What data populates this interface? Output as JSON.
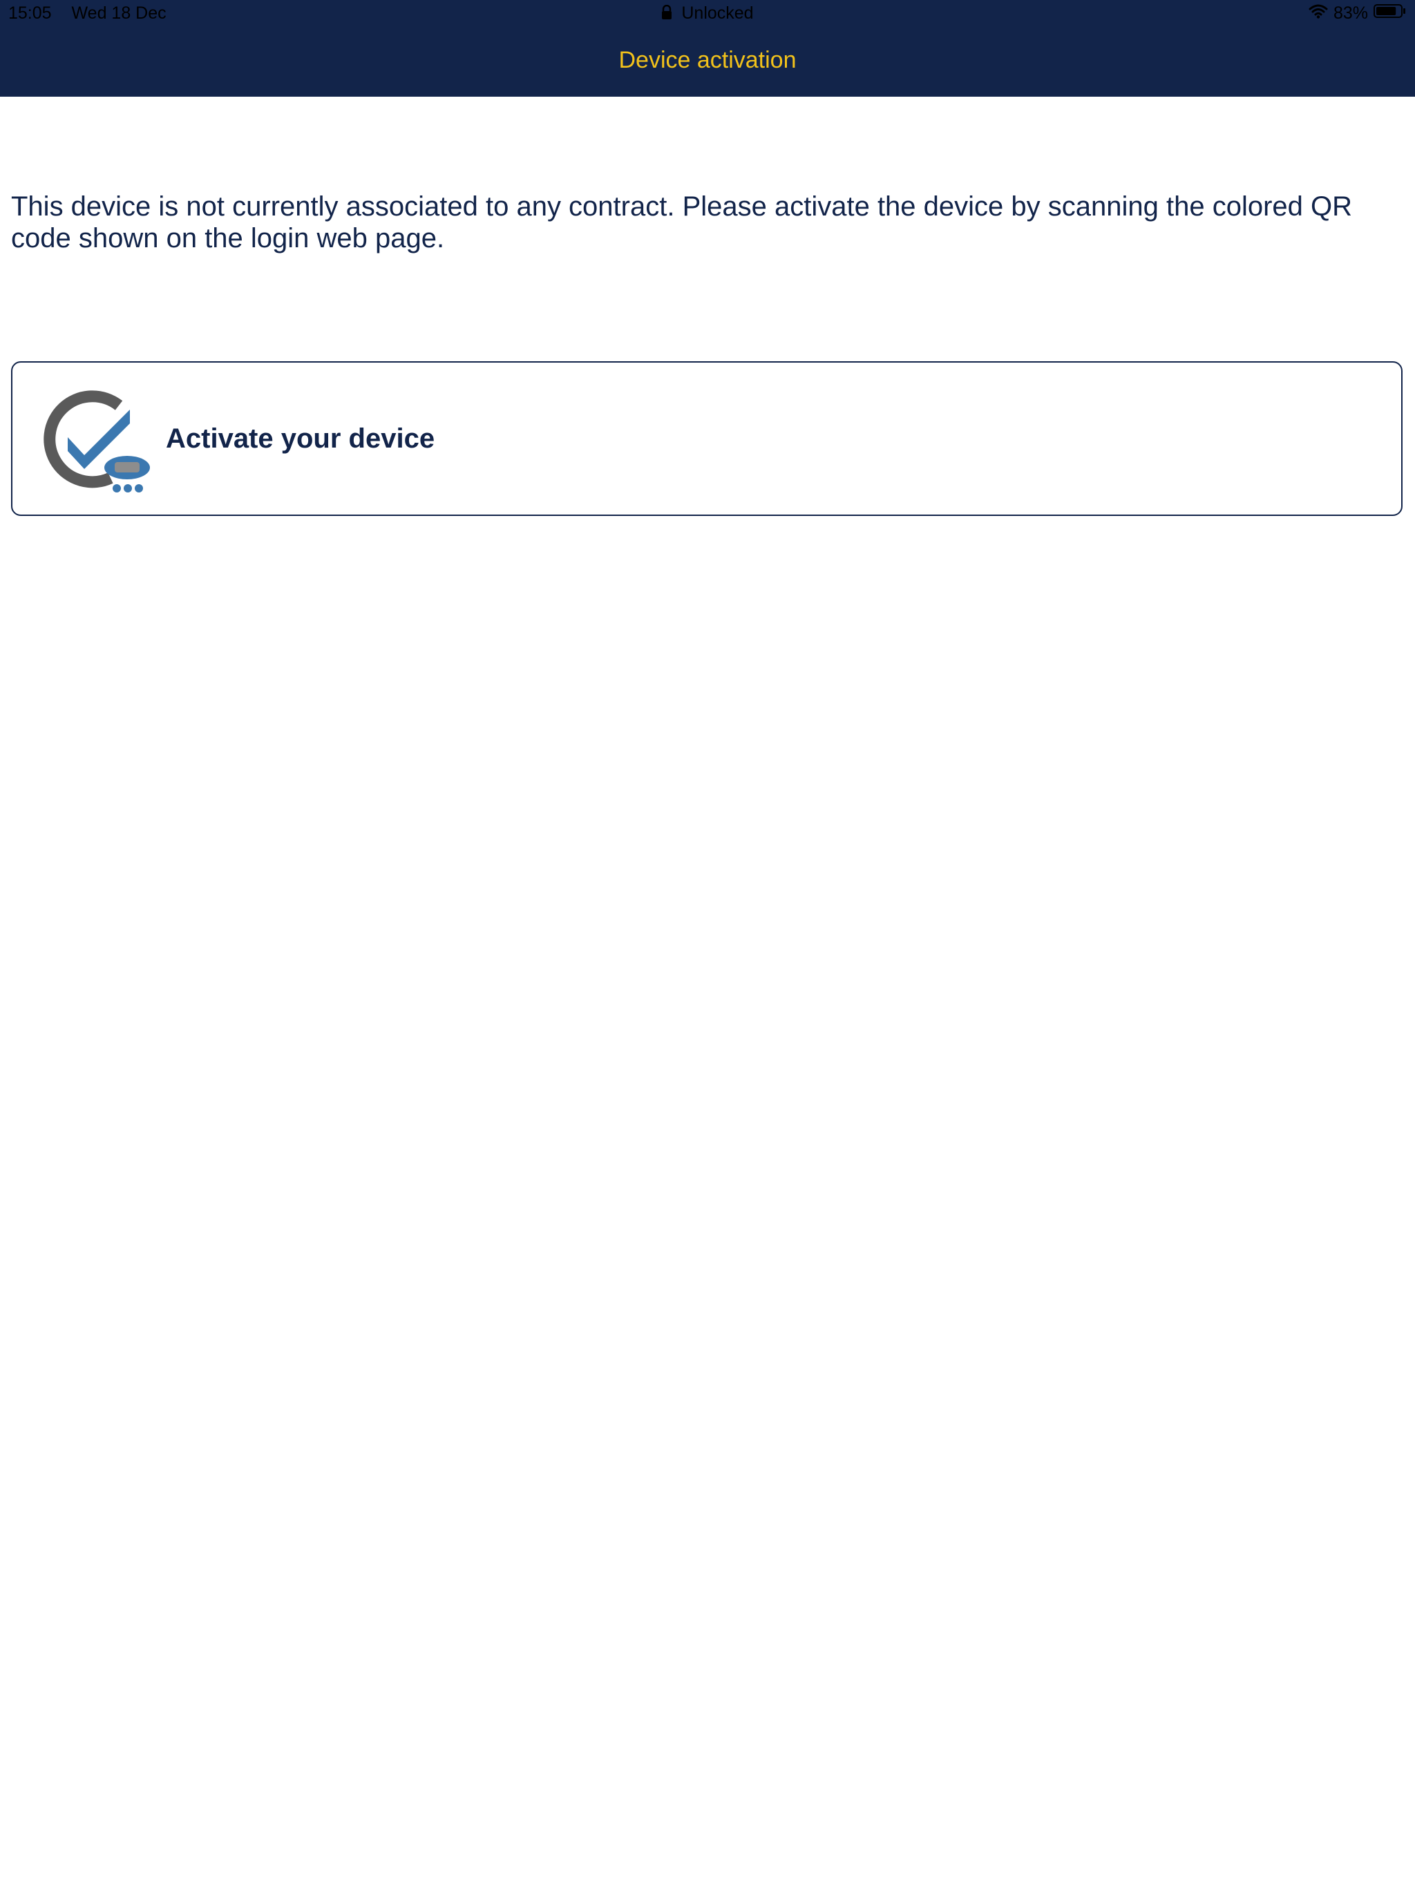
{
  "status_bar": {
    "time": "15:05",
    "date": "Wed 18 Dec",
    "lock_status": "Unlocked",
    "battery_percent": "83%",
    "battery_level": 0.83
  },
  "nav": {
    "title": "Device activation"
  },
  "content": {
    "message": "This device is not currently associated to any contract. Please activate the device by scanning the colored QR code shown on the login web page.",
    "activate_label": "Activate your device"
  },
  "colors": {
    "header_bg": "#12244a",
    "title": "#f2c21b",
    "text": "#12244a",
    "accent_blue": "#3b78b0",
    "icon_gray": "#5a5a5a"
  },
  "icons": {
    "lock": "lock-icon",
    "wifi": "wifi-icon",
    "battery": "battery-icon",
    "activate": "activate-device-icon"
  }
}
